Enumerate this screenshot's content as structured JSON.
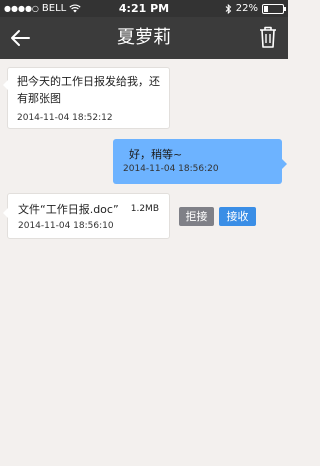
{
  "status_bar": {
    "carrier": "BELL",
    "time": "4:21 PM",
    "battery_percent": "22%",
    "battery_level": 0.22
  },
  "header": {
    "title": "夏萝莉",
    "back_icon": "back-arrow-icon",
    "delete_icon": "trash-icon"
  },
  "messages": [
    {
      "direction": "incoming",
      "text_line1": "把今天的工作日报发给我，还",
      "text_line2": "有那张图",
      "timestamp": "2014-11-04 18:52:12"
    },
    {
      "direction": "outgoing",
      "text": "好，稍等~",
      "timestamp": "2014-11-04 18:56:20"
    },
    {
      "direction": "incoming",
      "type": "file",
      "file_label": "文件“工作日报.doc”",
      "file_size": "1.2MB",
      "timestamp": "2014-11-04 18:56:10",
      "reject_label": "拒接",
      "accept_label": "接收"
    }
  ],
  "colors": {
    "header_bg": "#3b3b3b",
    "status_bg": "#333333",
    "page_bg": "#f3f0ee",
    "outgoing_bubble": "#6db3ff",
    "accept_button": "#3a8ee6",
    "reject_button": "#7f8087"
  }
}
